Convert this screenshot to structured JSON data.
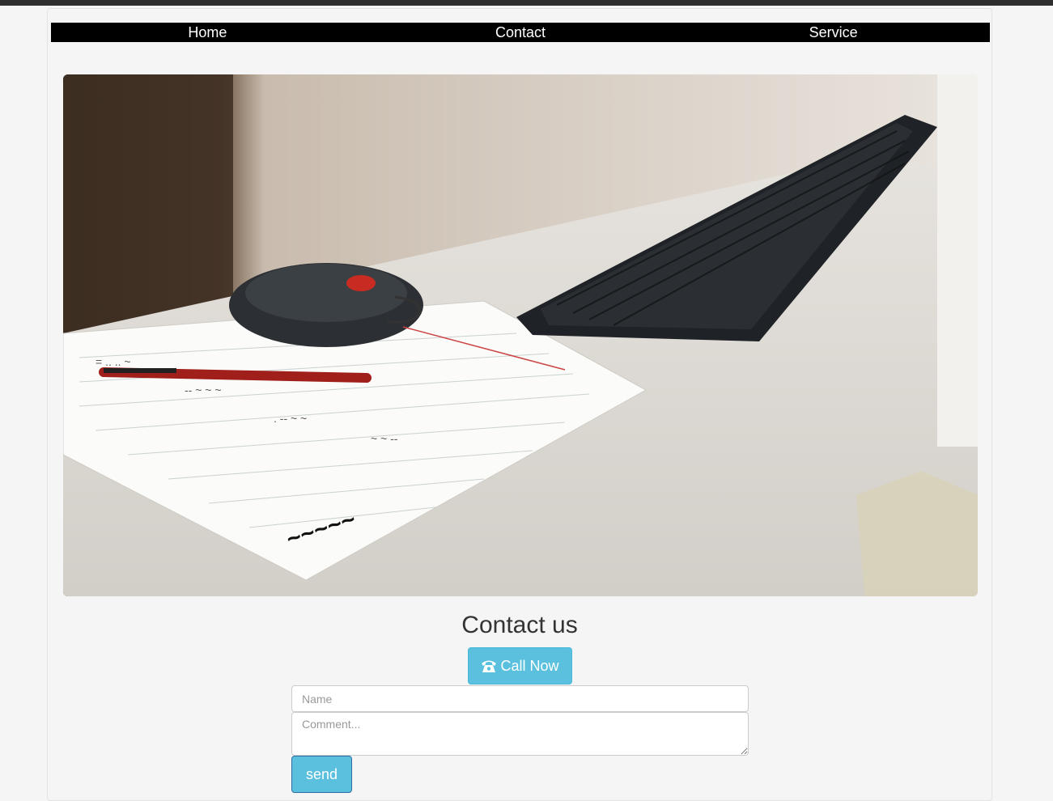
{
  "nav": {
    "items": [
      {
        "label": "Home"
      },
      {
        "label": "Contact"
      },
      {
        "label": "Service"
      }
    ]
  },
  "hero": {
    "image": "desk-keyboard-mouse-notebook-photo",
    "alt_description_icon": "photo"
  },
  "contact": {
    "title": "Contact us",
    "call_button": {
      "label": "Call Now",
      "icon": "phone-icon"
    },
    "name_placeholder": "Name",
    "comment_placeholder": "Comment...",
    "send_label": "send"
  },
  "colors": {
    "nav_bg": "#000000",
    "button": "#5bc0de",
    "background": "#f5f5f5"
  }
}
